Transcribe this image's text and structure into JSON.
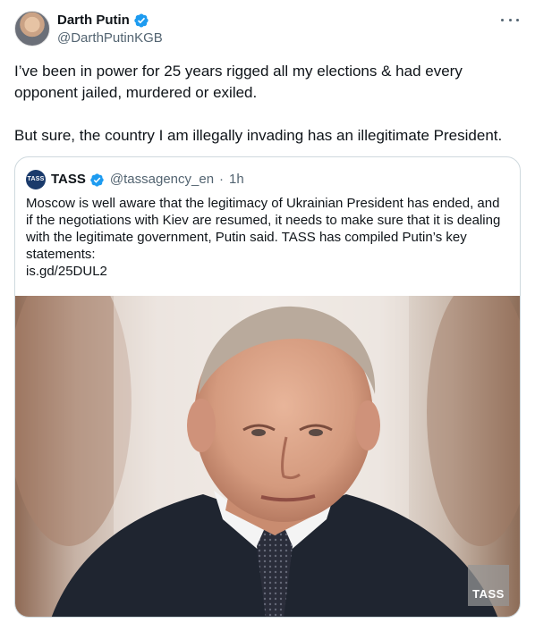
{
  "tweet": {
    "display_name": "Darth Putin",
    "handle": "@DarthPutinKGB",
    "text_p1": "I’ve been in power for 25 years rigged all my elections & had every opponent jailed, murdered or exiled.",
    "text_p2": "But sure, the country I am illegally invading has an illegitimate President."
  },
  "quote": {
    "logo_text": "TASS",
    "name": "TASS",
    "handle": "@tassagency_en",
    "separator": "·",
    "time": "1h",
    "text": "Moscow is well aware that the legitimacy of Ukrainian President has ended, and if the negotiations with Kiev are resumed, it needs to make sure that it is dealing with the legitimate government, Putin said. TASS has compiled Putin’s key statements:",
    "link": "is.gd/25DUL2",
    "watermark": "TASS"
  },
  "colors": {
    "verified_blue": "#1d9bf0",
    "text_primary": "#0f1419",
    "text_secondary": "#536471",
    "border": "#cfd9de"
  },
  "icons": {
    "verified": "verified-badge-icon",
    "more": "more-horizontal-icon"
  }
}
